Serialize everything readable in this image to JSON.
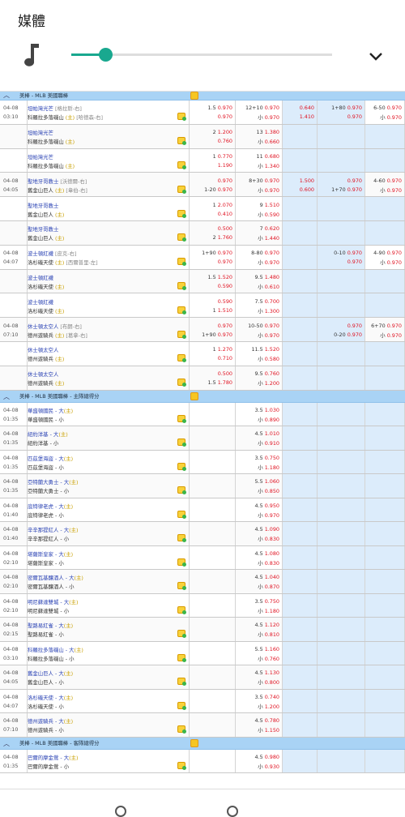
{
  "media": {
    "title": "媒體",
    "icon": "music-note-icon",
    "slider_fraction": 0.13,
    "accent": "#19a88f"
  },
  "leagues": [
    {
      "name": "美棒 - MLB 美國職棒",
      "games": [
        {
          "date": "04-08",
          "time": "03:10",
          "rows": [
            {
              "away": "坦帕灣光芒",
              "away_p": "[格拉斯-右]",
              "home": "科羅拉多落磯山",
              "home_p": "[哈德森-右]",
              "hc": "1.5 0.970\n0.970",
              "ou": "12+10 0.970\n小 0.970",
              "c3": "0.640\n1.410",
              "c4": "1+80 0.970\n0.970",
              "c5": "6-50 0.970\n小 0.970"
            },
            {
              "away": "坦帕灣光芒",
              "home": "科羅拉多落磯山",
              "hc": "2 1.200\n0.760",
              "ou": "13 1.380\n小 0.660"
            },
            {
              "away": "坦帕灣光芒",
              "home": "科羅拉多落磯山",
              "hc": "1 0.770\n1.190",
              "ou": "11 0.680\n小 1.340"
            }
          ]
        },
        {
          "date": "04-08",
          "time": "04:05",
          "rows": [
            {
              "away": "聖地牙哥教士",
              "away_p": "[沃德爾-右]",
              "home": "舊金山巨人",
              "home_p": "[韋伯-右]",
              "hc": "0.970\n1-20 0.970",
              "ou": "8+30 0.970\n小 0.970",
              "c3": "1.500\n0.600",
              "c4": "0.970\n1+70 0.970",
              "c5": "4-60 0.970\n小 0.970"
            },
            {
              "away": "聖地牙哥教士",
              "home": "舊金山巨人",
              "hc": "1 2.070\n0.410",
              "ou": "9 1.510\n小 0.590"
            },
            {
              "away": "聖地牙哥教士",
              "home": "舊金山巨人",
              "hc": "0.500\n2 1.760",
              "ou": "7 0.620\n小 1.440"
            }
          ]
        },
        {
          "date": "04-08",
          "time": "04:07",
          "rows": [
            {
              "away": "波士頓紅襪",
              "away_p": "[皮克-右]",
              "home": "洛杉磯天使",
              "home_p": "[西爾普里-左]",
              "hc": "1+90 0.970\n0.970",
              "ou": "8-80 0.970\n小 0.970",
              "c4": "0-10 0.970\n0.970",
              "c5": "4-90 0.970\n小 0.970"
            },
            {
              "away": "波士頓紅襪",
              "home": "洛杉磯天使",
              "hc": "1.5 1.520\n0.590",
              "ou": "9.5 1.480\n小 0.610"
            },
            {
              "away": "波士頓紅襪",
              "home": "洛杉磯天使",
              "hc": "0.590\n1 1.510",
              "ou": "7.5 0.700\n小 1.300"
            }
          ]
        },
        {
          "date": "04-08",
          "time": "07:10",
          "rows": [
            {
              "away": "休士頓太空人",
              "away_p": "[布朗-右]",
              "home": "德州遊騎兵",
              "home_p": "[葛拿-右]",
              "hc": "0.970\n1+90 0.970",
              "ou": "10-50 0.970\n小 0.970",
              "c4": "0.970\n0-20 0.970",
              "c5": "6+70 0.970\n小 0.970"
            },
            {
              "away": "休士頓太空人",
              "home": "德州遊騎兵",
              "hc": "1 1.270\n0.710",
              "ou": "11.5 1.520\n小 0.580"
            },
            {
              "away": "休士頓太空人",
              "home": "德州遊騎兵",
              "hc": "0.500\n1.5 1.780",
              "ou": "9.5 0.760\n小 1.200"
            }
          ]
        }
      ]
    },
    {
      "name": "美棒 - MLB 美國職棒 - 主隊總得分",
      "big": true,
      "games": [
        {
          "date": "04-08",
          "time": "01:35",
          "rows": [
            {
              "away": "華盛頓國民 - 大",
              "home": "華盛頓國民 - 小",
              "ou": "3.5 1.030\n小 0.890"
            }
          ]
        },
        {
          "date": "04-08",
          "time": "01:35",
          "rows": [
            {
              "away": "紐約洋基 - 大",
              "home": "紐約洋基 - 小",
              "ou": "4.5 1.010\n小 0.910"
            }
          ]
        },
        {
          "date": "04-08",
          "time": "01:35",
          "rows": [
            {
              "away": "匹茲堡海盜 - 大",
              "home": "匹茲堡海盜 - 小",
              "ou": "3.5 0.750\n小 1.180"
            }
          ]
        },
        {
          "date": "04-08",
          "time": "01:35",
          "rows": [
            {
              "away": "亞特蘭大勇士 - 大",
              "home": "亞特蘭大勇士 - 小",
              "ou": "5.5 1.060\n小 0.850"
            }
          ]
        },
        {
          "date": "04-08",
          "time": "01:40",
          "rows": [
            {
              "away": "底特律老虎 - 大",
              "home": "底特律老虎 - 小",
              "ou": "4.5 0.950\n小 0.970"
            }
          ]
        },
        {
          "date": "04-08",
          "time": "01:40",
          "rows": [
            {
              "away": "辛辛那提紅人 - 大",
              "home": "辛辛那提紅人 - 小",
              "ou": "4.5 1.090\n小 0.830"
            }
          ]
        },
        {
          "date": "04-08",
          "time": "02:10",
          "rows": [
            {
              "away": "堪薩斯皇家 - 大",
              "home": "堪薩斯皇家 - 小",
              "ou": "4.5 1.080\n小 0.830"
            }
          ]
        },
        {
          "date": "04-08",
          "time": "02:10",
          "rows": [
            {
              "away": "密爾瓦基釀酒人 - 大",
              "home": "密爾瓦基釀酒人 - 小",
              "ou": "4.5 1.040\n小 0.870"
            }
          ]
        },
        {
          "date": "04-08",
          "time": "02:10",
          "rows": [
            {
              "away": "明尼蘇達雙城 - 大",
              "home": "明尼蘇達雙城 - 小",
              "ou": "3.5 0.750\n小 1.180"
            }
          ]
        },
        {
          "date": "04-08",
          "time": "02:15",
          "rows": [
            {
              "away": "聖路易紅雀 - 大",
              "home": "聖路易紅雀 - 小",
              "ou": "4.5 1.120\n小 0.810"
            }
          ]
        },
        {
          "date": "04-08",
          "time": "03:10",
          "rows": [
            {
              "away": "科羅拉多落磯山 - 大",
              "home": "科羅拉多落磯山 - 小",
              "ou": "5.5 1.160\n小 0.760"
            }
          ]
        },
        {
          "date": "04-08",
          "time": "04:05",
          "rows": [
            {
              "away": "舊金山巨人 - 大",
              "home": "舊金山巨人 - 小",
              "ou": "4.5 1.130\n小 0.800"
            }
          ]
        },
        {
          "date": "04-08",
          "time": "04:07",
          "rows": [
            {
              "away": "洛杉磯天使 - 大",
              "home": "洛杉磯天使 - 小",
              "ou": "3.5 0.740\n小 1.200"
            }
          ]
        },
        {
          "date": "04-08",
          "time": "07:10",
          "rows": [
            {
              "away": "德州遊騎兵 - 大",
              "home": "德州遊騎兵 - 小",
              "ou": "4.5 0.780\n小 1.150"
            }
          ]
        }
      ]
    },
    {
      "name": "美棒 - MLB 美國職棒 - 客隊總得分",
      "big": true,
      "games": [
        {
          "date": "04-08",
          "time": "01:35",
          "rows": [
            {
              "away": "巴爾的摩金鶯 - 大",
              "home": "巴爾的摩金鶯 - 小",
              "ou": "4.5 0.980\n小 0.930"
            }
          ]
        }
      ]
    }
  ]
}
